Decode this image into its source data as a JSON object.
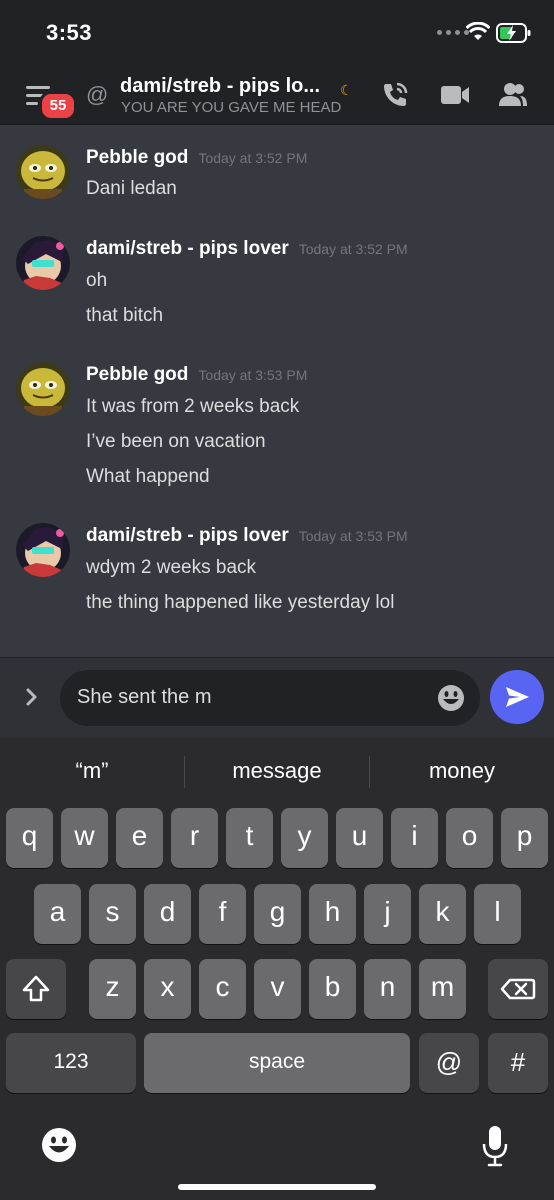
{
  "status": {
    "time": "3:53"
  },
  "header": {
    "badge": "55",
    "title": "dami/streb - pips lo...",
    "subtitle": "YOU ARE YOU GAVE ME HEAD"
  },
  "messages": [
    {
      "author": "Pebble god",
      "time": "Today at 3:52 PM",
      "lines": [
        "Dani ledan"
      ]
    },
    {
      "author": "dami/streb - pips lover",
      "time": "Today at 3:52 PM",
      "lines": [
        "oh",
        "that bitch"
      ]
    },
    {
      "author": "Pebble god",
      "time": "Today at 3:53 PM",
      "lines": [
        "It was from 2 weeks back",
        "I’ve been on vacation",
        "What happend"
      ]
    },
    {
      "author": "dami/streb - pips lover",
      "time": "Today at 3:53 PM",
      "lines": [
        "wdym 2 weeks back",
        "the thing happened like yesterday lol"
      ]
    }
  ],
  "composer": {
    "text": "She sent the m"
  },
  "keyboard": {
    "suggestions": [
      "“m”",
      "message",
      "money"
    ],
    "row1": [
      "q",
      "w",
      "e",
      "r",
      "t",
      "y",
      "u",
      "i",
      "o",
      "p"
    ],
    "row2": [
      "a",
      "s",
      "d",
      "f",
      "g",
      "h",
      "j",
      "k",
      "l"
    ],
    "row3": [
      "z",
      "x",
      "c",
      "v",
      "b",
      "n",
      "m"
    ],
    "numbers_label": "123",
    "space_label": "space",
    "at_label": "@",
    "hash_label": "#"
  },
  "icons": {
    "menu": "hamburger-menu-icon",
    "call": "phone-call-icon",
    "video": "video-camera-icon",
    "members": "members-icon",
    "expand": "chevron-right-icon",
    "emoji": "emoji-icon",
    "send": "send-icon",
    "shift": "shift-icon",
    "backspace": "backspace-icon",
    "mic": "microphone-icon"
  },
  "colors": {
    "accent": "#5865f2",
    "badge": "#ed4245",
    "background": "#36393f"
  }
}
